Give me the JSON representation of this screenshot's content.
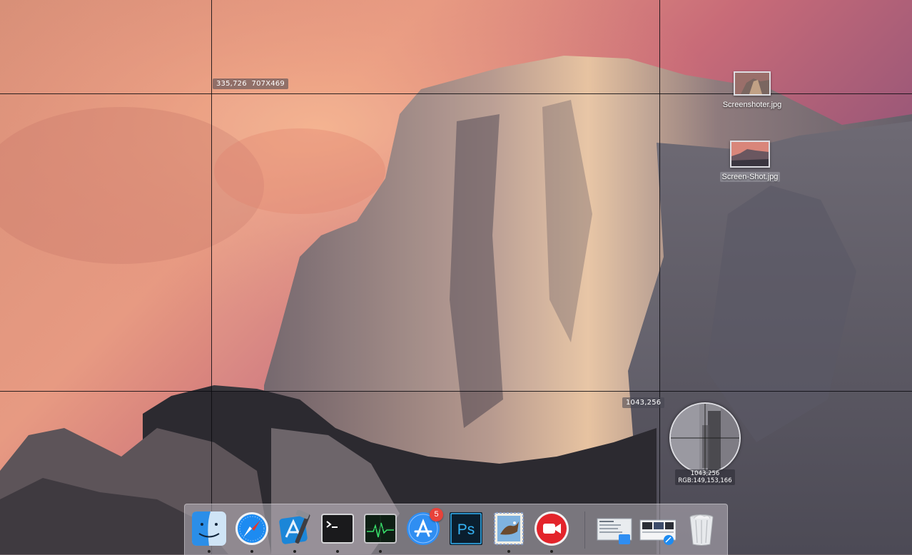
{
  "overlay": {
    "selection_origin_and_size": "335,726  707X469",
    "cursor_position": "1043,256",
    "magnifier": {
      "position": "1043,256",
      "color": "RGB:149,153,166"
    }
  },
  "desktop_files": [
    {
      "label": "Screenshoter.jpg",
      "icon": "image-file-icon"
    },
    {
      "label": "Screen-Shot.jpg",
      "icon": "image-file-icon"
    }
  ],
  "dock": {
    "apps": [
      {
        "name": "Finder",
        "icon": "finder-icon",
        "running": true
      },
      {
        "name": "Safari",
        "icon": "safari-icon",
        "running": true
      },
      {
        "name": "Xcode",
        "icon": "xcode-icon",
        "running": true
      },
      {
        "name": "Terminal",
        "icon": "terminal-icon",
        "running": true
      },
      {
        "name": "Activity Monitor",
        "icon": "activity-monitor-icon",
        "running": true
      },
      {
        "name": "App Store",
        "icon": "app-store-icon",
        "running": false,
        "badge": "5"
      },
      {
        "name": "Photoshop",
        "icon": "photoshop-icon",
        "running": false,
        "text": "Ps"
      },
      {
        "name": "Mail",
        "icon": "mail-icon",
        "running": true
      },
      {
        "name": "Screen Recorder",
        "icon": "record-icon",
        "running": true
      }
    ],
    "stacks": [
      {
        "name": "Documents",
        "icon": "documents-stack-icon"
      },
      {
        "name": "Downloads",
        "icon": "downloads-stack-icon"
      },
      {
        "name": "Trash",
        "icon": "trash-icon"
      }
    ]
  },
  "colors": {
    "sky_top": "#c8626f",
    "sky_glow": "#f4a386",
    "rock": "#7a6b6e",
    "badge": "#e8423a"
  }
}
